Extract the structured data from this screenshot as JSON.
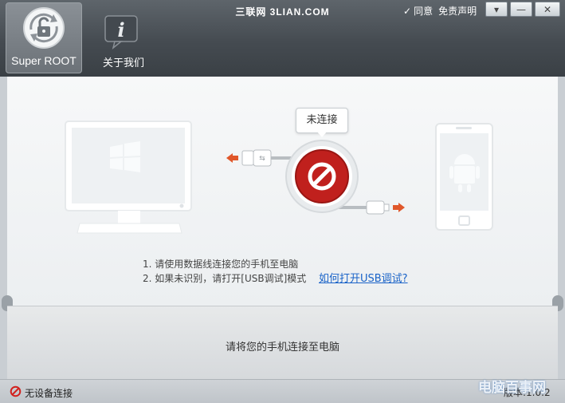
{
  "window": {
    "brand": "三联网 3LIAN.COM",
    "agree_label": "同意",
    "disclaimer_label": "免责声明",
    "controls": {
      "menu": "▾",
      "minimize": "—",
      "close": "✕"
    }
  },
  "tabs": [
    {
      "label": "Super ROOT",
      "icon": "unlock-refresh-icon",
      "selected": true
    },
    {
      "label": "关于我们",
      "icon": "info-chat-icon",
      "selected": false
    }
  ],
  "connection": {
    "status_bubble": "未连接",
    "center_icon": "prohibited-icon"
  },
  "instructions": [
    "1. 请使用数据线连接您的手机至电脑",
    "2. 如果未识别，请打开[USB调试]模式"
  ],
  "usb_debug_link": "如何打开USB调试?",
  "lower_message": "请将您的手机连接至电脑",
  "status": {
    "text": "无设备连接",
    "icon": "no-entry-icon",
    "version": "版本:1.0.2"
  },
  "watermark": "电脑百事网",
  "colors": {
    "accent_red": "#c0201d",
    "arrow_orange": "#e0572a",
    "link_blue": "#1a63c8"
  }
}
